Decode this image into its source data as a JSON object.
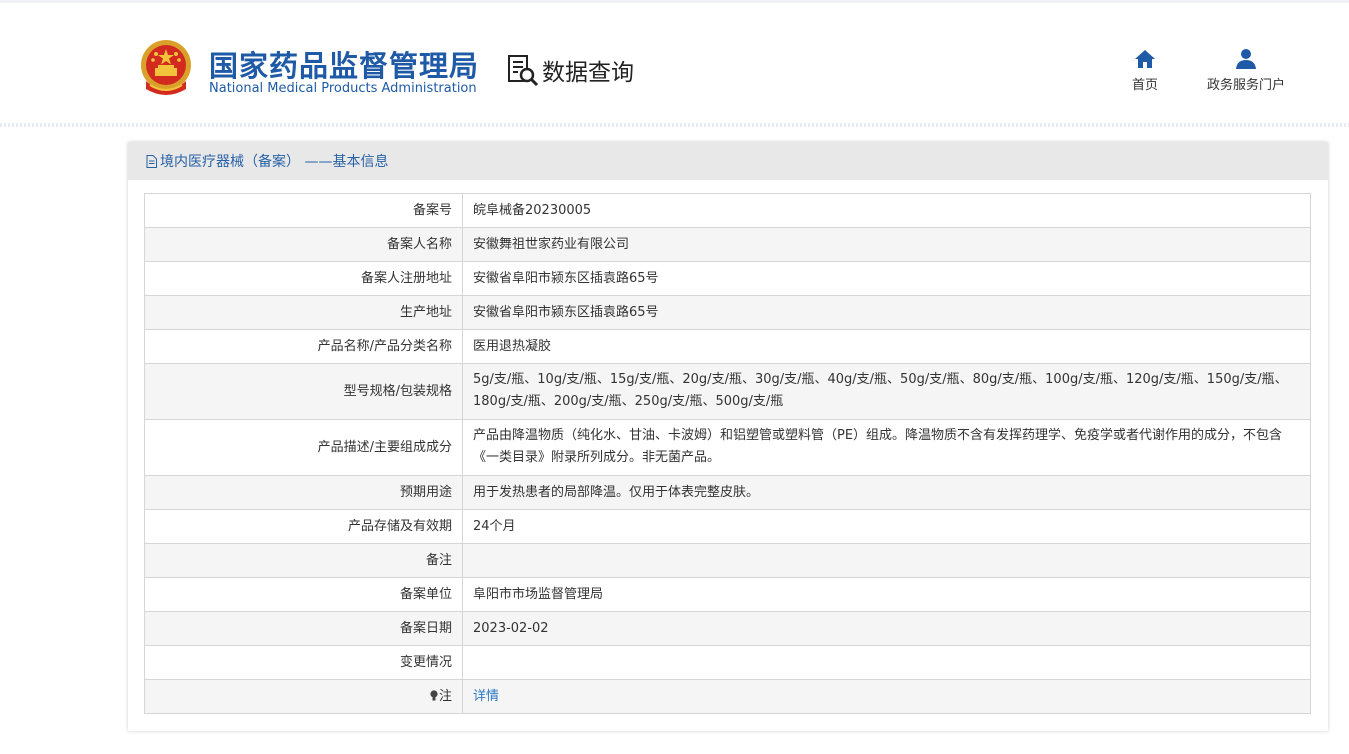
{
  "header": {
    "title_cn": "国家药品监督管理局",
    "title_en": "National Medical Products Administration",
    "query_label": "数据查询",
    "nav": [
      {
        "label": "首页",
        "icon": "home-icon"
      },
      {
        "label": "政务服务门户",
        "icon": "user-icon"
      }
    ]
  },
  "panel": {
    "title": "境内医疗器械（备案） ——基本信息",
    "rows": [
      {
        "key": "备案号",
        "value": "皖阜械备20230005"
      },
      {
        "key": "备案人名称",
        "value": "安徽舞祖世家药业有限公司"
      },
      {
        "key": "备案人注册地址",
        "value": "安徽省阜阳市颍东区插袁路65号"
      },
      {
        "key": "生产地址",
        "value": "安徽省阜阳市颍东区插袁路65号"
      },
      {
        "key": "产品名称/产品分类名称",
        "value": "医用退热凝胶"
      },
      {
        "key": "型号规格/包装规格",
        "value": "5g/支/瓶、10g/支/瓶、15g/支/瓶、20g/支/瓶、30g/支/瓶、40g/支/瓶、50g/支/瓶、80g/支/瓶、100g/支/瓶、120g/支/瓶、150g/支/瓶、180g/支/瓶、200g/支/瓶、250g/支/瓶、500g/支/瓶"
      },
      {
        "key": "产品描述/主要组成成分",
        "value": "产品由降温物质（纯化水、甘油、卡波姆）和铝塑管或塑料管（PE）组成。降温物质不含有发挥药理学、免疫学或者代谢作用的成分，不包含《一类目录》附录所列成分。非无菌产品。"
      },
      {
        "key": "预期用途",
        "value": "用于发热患者的局部降温。仅用于体表完整皮肤。"
      },
      {
        "key": "产品存储及有效期",
        "value": "24个月"
      },
      {
        "key": "备注",
        "value": ""
      },
      {
        "key": "备案单位",
        "value": "阜阳市市场监督管理局"
      },
      {
        "key": "备案日期",
        "value": "2023-02-02"
      },
      {
        "key": "变更情况",
        "value": ""
      },
      {
        "key": "注",
        "value": "详情"
      }
    ]
  },
  "colors": {
    "brand_blue": "#1f5aa6",
    "link_blue": "#2b78c8",
    "header_gray": "#e8e8e8"
  }
}
